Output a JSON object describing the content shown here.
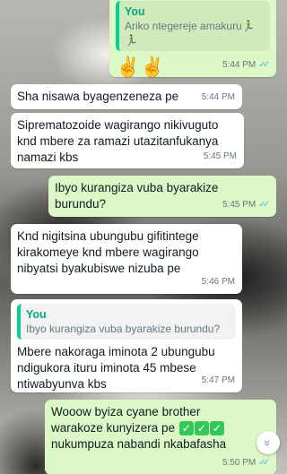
{
  "messages": [
    {
      "id": "m1",
      "direction": "outgoing",
      "quote": {
        "author": "You",
        "text": "Ariko ntegereje amakuru🏃‍♂️🏃‍♂️"
      },
      "text": "✌✌",
      "time": "5:44 PM",
      "status_icon": "double-check-icon"
    },
    {
      "id": "m2",
      "direction": "incoming",
      "text": "Sha nisawa byagenzeneza pe",
      "time": "5:44 PM"
    },
    {
      "id": "m3",
      "direction": "incoming",
      "text": "Siprematozoide wagirango nikivuguto knd mbere za ramazi utazitanfukanya namazi kbs",
      "time": "5:45 PM"
    },
    {
      "id": "m4",
      "direction": "outgoing",
      "text": "Ibyo kurangiza vuba byarakize burundu?",
      "time": "5:45 PM",
      "status_icon": "double-check-icon"
    },
    {
      "id": "m5",
      "direction": "incoming",
      "text": "Knd nigitsina ubungubu gifitintege kirakomeye knd mbere wagirango nibyatsi byakubiswe nizuba pe",
      "time": "5:46 PM"
    },
    {
      "id": "m6",
      "direction": "incoming",
      "quote": {
        "author": "You",
        "text": "Ibyo kurangiza vuba byarakize burundu?"
      },
      "text": "Mbere nakoraga iminota 2  ubungubu ndigukora ituru iminota 45 mbese ntiwabyunva kbs",
      "time": "5:47 PM"
    },
    {
      "id": "m7",
      "direction": "outgoing",
      "text_before": "Wooow byiza cyane brother warakoze kunyizera pe",
      "text_after": "nukumpuza nabandi nkabafasha",
      "time": "5:50 PM",
      "status_icon": "double-check-icon"
    }
  ],
  "icons": {
    "scroll_down": "chevron-double-down-icon",
    "check_box_emoji": "check-mark-button-icon"
  },
  "colors": {
    "incoming_bubble": "#ffffff",
    "outgoing_bubble": "#dcf8c6",
    "quote_accent": "#06cf9c",
    "read_ticks": "#4fb6ec"
  }
}
